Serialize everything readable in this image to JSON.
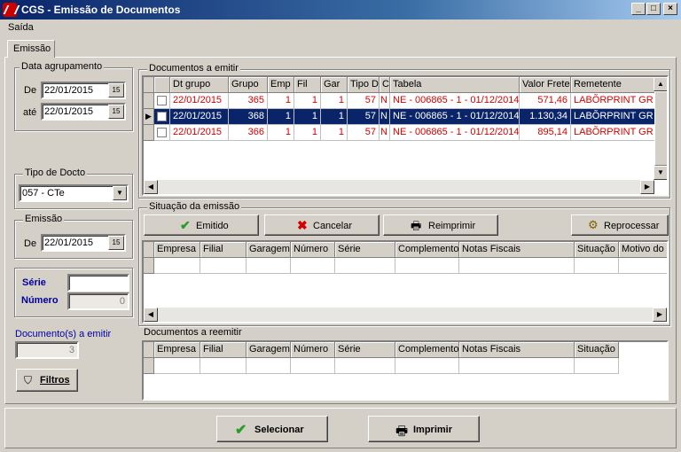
{
  "window": {
    "title": "CGS - Emissão de Documentos",
    "min": "_",
    "max": "□",
    "close": "×"
  },
  "menu": {
    "saida": "Saída"
  },
  "tab": {
    "emissao": "Emissão"
  },
  "data_agrupamento": {
    "label": "Data agrupamento",
    "de_label": "De",
    "de_value": "22/01/2015",
    "ate_label": "até",
    "ate_value": "22/01/2015",
    "cal_icon": "15"
  },
  "tipo_docto": {
    "label": "Tipo de Docto",
    "value": "057 - CTe"
  },
  "emissao": {
    "label": "Emissão",
    "de_label": "De",
    "de_value": "22/01/2015"
  },
  "serie": {
    "label": "Série",
    "value": ""
  },
  "numero": {
    "label": "Número",
    "value": "0"
  },
  "docs_emitir_count": {
    "label": "Documento(s) a emitir",
    "value": "3"
  },
  "filtros_button": "Filtros",
  "documentos_emitir": {
    "label": "Documentos a emitir",
    "columns": [
      "Dt grupo",
      "Grupo",
      "Emp",
      "Fil",
      "Gar",
      "Tipo D",
      "C",
      "Tabela",
      "Valor Frete",
      "Remetente"
    ],
    "rows": [
      {
        "dt": "22/01/2015",
        "grupo": "365",
        "emp": "1",
        "fil": "1",
        "gar": "1",
        "tipo": "57",
        "c": "N",
        "tabela": "NE - 006865 - 1 - 01/12/2014",
        "valor": "571,46",
        "remetente": "LABÕRPRINT GR"
      },
      {
        "dt": "22/01/2015",
        "grupo": "368",
        "emp": "1",
        "fil": "1",
        "gar": "1",
        "tipo": "57",
        "c": "N",
        "tabela": "NE - 006865 - 1 - 01/12/2014",
        "valor": "1.130,34",
        "remetente": "LABÕRPRINT GR"
      },
      {
        "dt": "22/01/2015",
        "grupo": "366",
        "emp": "1",
        "fil": "1",
        "gar": "1",
        "tipo": "57",
        "c": "N",
        "tabela": "NE - 006865 - 1 - 01/12/2014",
        "valor": "895,14",
        "remetente": "LABÕRPRINT GR"
      }
    ]
  },
  "situacao": {
    "label": "Situação da emissão",
    "buttons": {
      "emitido": "Emitido",
      "cancelar": "Cancelar",
      "reimprimir": "Reimprimir",
      "reprocessar": "Reprocessar"
    },
    "columns": [
      "Empresa",
      "Filial",
      "Garagem",
      "Número",
      "Série",
      "Complemento",
      "Notas Fiscais",
      "Situação",
      "Motivo do c"
    ]
  },
  "reemitir": {
    "label": "Documentos a reemitir",
    "columns": [
      "Empresa",
      "Filial",
      "Garagem",
      "Número",
      "Série",
      "Complemento",
      "Notas Fiscais",
      "Situação"
    ]
  },
  "footer": {
    "selecionar": "Selecionar",
    "imprimir": "Imprimir"
  },
  "colors": {
    "title_start": "#0a246a",
    "title_end": "#a6caf0",
    "row_text": "#d40000",
    "selected": "#0a246a",
    "label_blue": "#0000a0"
  }
}
